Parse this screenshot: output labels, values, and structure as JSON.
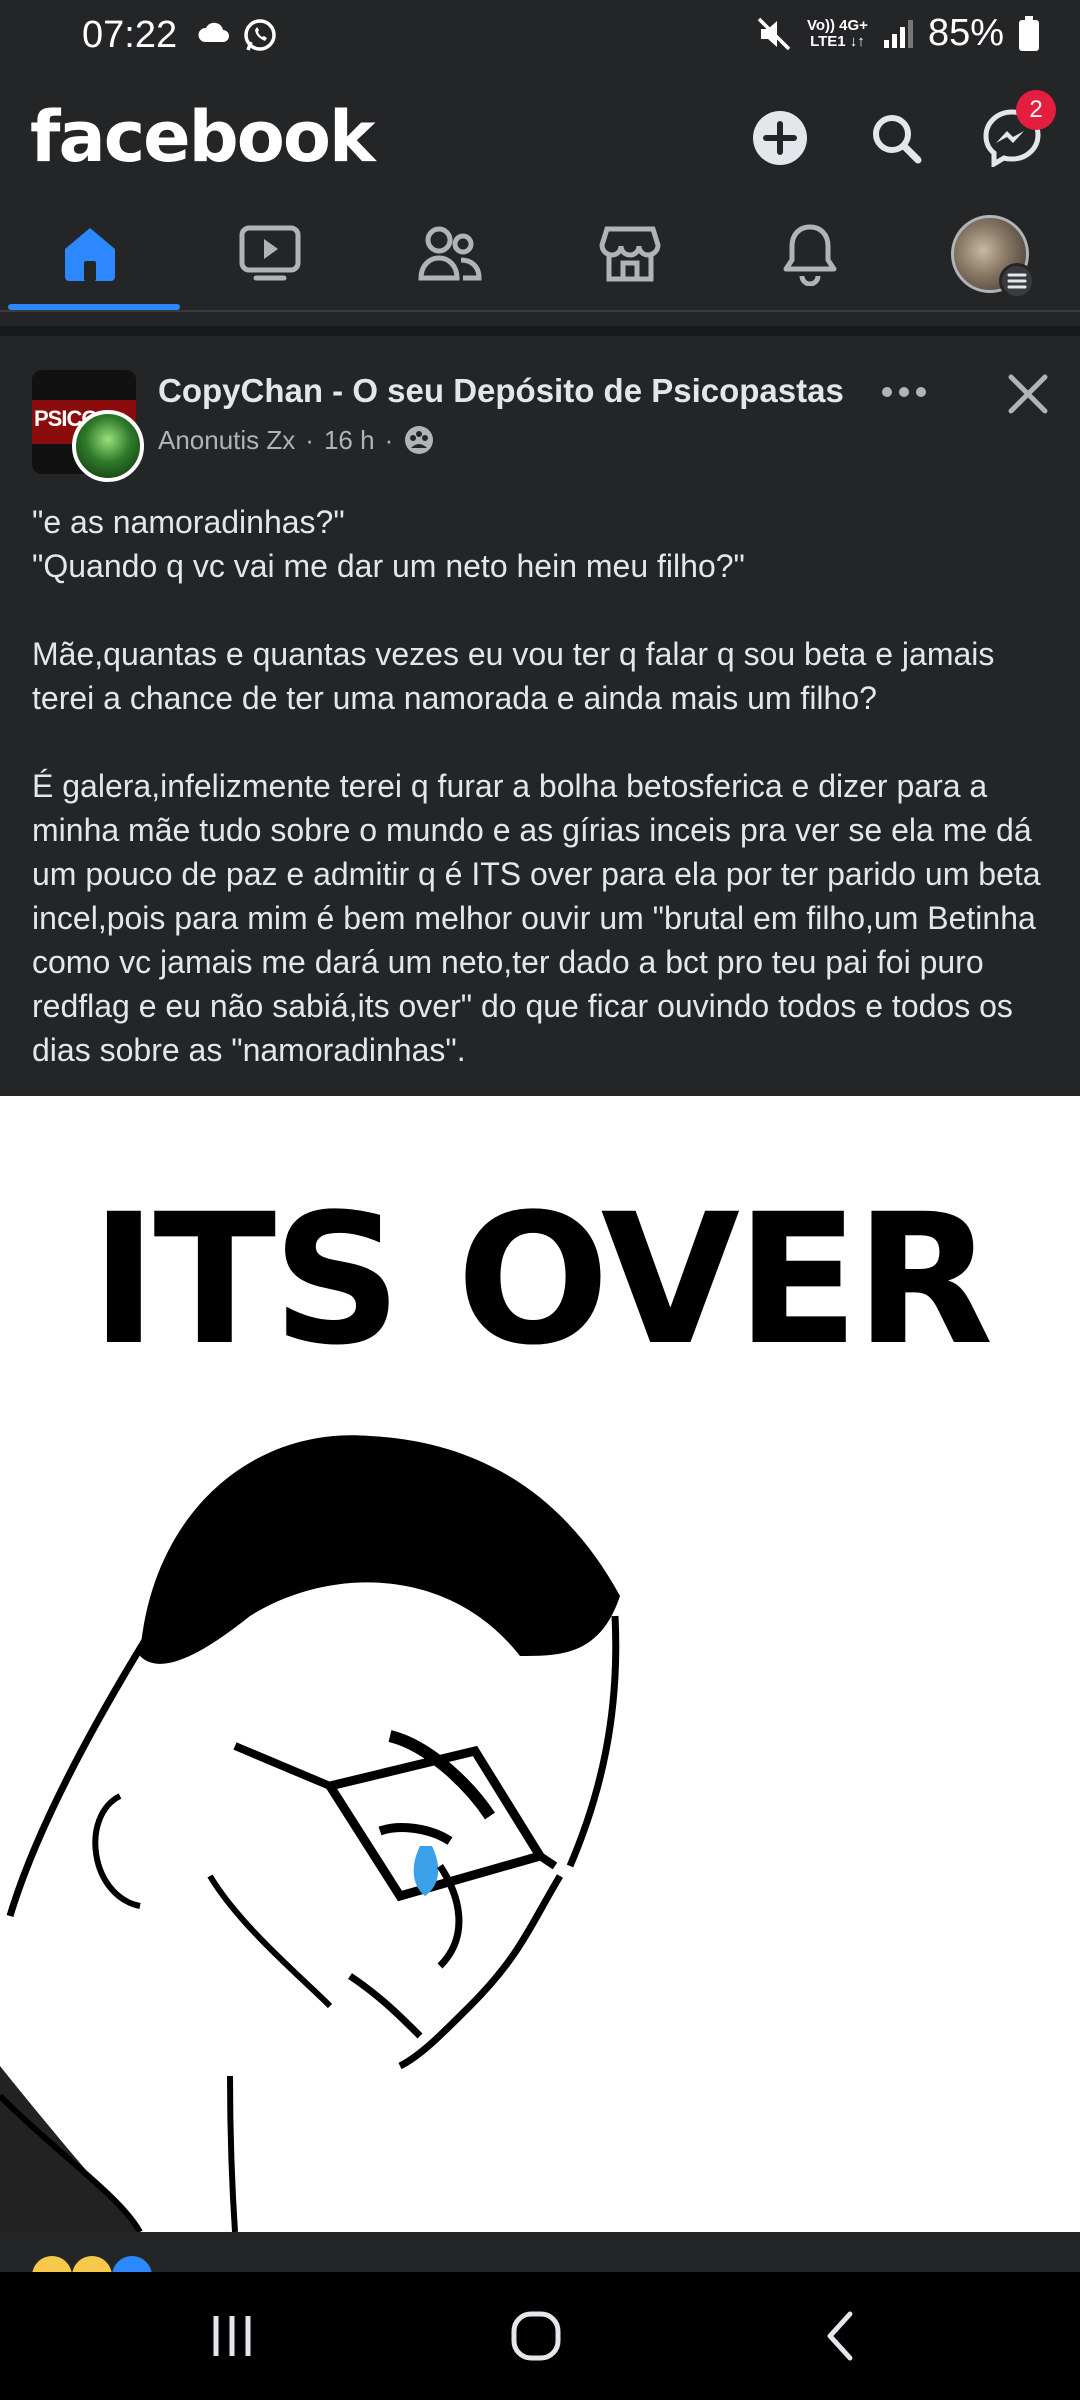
{
  "status_bar": {
    "time": "07:22",
    "network_top": "Vo)) 4G+",
    "network_bottom": "LTE1 ↓↑",
    "battery": "85%"
  },
  "header": {
    "logo": "facebook",
    "messenger_badge": "2",
    "icons": [
      "plus-icon",
      "search-icon",
      "messenger-icon"
    ]
  },
  "tabs": [
    {
      "name": "home",
      "icon": "home-icon",
      "active": true
    },
    {
      "name": "watch",
      "icon": "video-icon",
      "active": false
    },
    {
      "name": "friends",
      "icon": "friends-icon",
      "active": false
    },
    {
      "name": "marketplace",
      "icon": "marketplace-icon",
      "active": false
    },
    {
      "name": "notifications",
      "icon": "bell-icon",
      "active": false
    },
    {
      "name": "profile-menu",
      "icon": "avatar",
      "active": false
    }
  ],
  "post": {
    "page_name": "CopyChan - O seu Depósito de Psicopastas",
    "author": "Anonutis Zx",
    "time": "16 h",
    "paragraphs": [
      "\"e as namoradinhas?\"\n\"Quando q vc vai me dar um neto hein meu filho?\"",
      "Mãe,quantas e quantas vezes eu vou ter q falar q sou beta e jamais terei a chance de ter uma namorada e ainda mais um filho?",
      "É galera,infelizmente terei q furar a bolha betosferica e dizer para a minha mãe tudo sobre o mundo e as gírias inceis pra ver se ela me dá um  pouco de paz e admitir q é ITS over para ela por ter parido um beta incel,pois para mim é bem melhor ouvir um \"brutal em filho,um Betinha como vc jamais me dará um neto,ter dado a bct pro teu pai foi puro redflag e eu não sabiá,its over\" do que ficar ouvindo todos e todos os dias sobre as \"namoradinhas\"."
    ],
    "image_text": "ITS OVER"
  },
  "colors": {
    "background": "#242526",
    "accent": "#2d88ff",
    "badge": "#e41e3f"
  }
}
